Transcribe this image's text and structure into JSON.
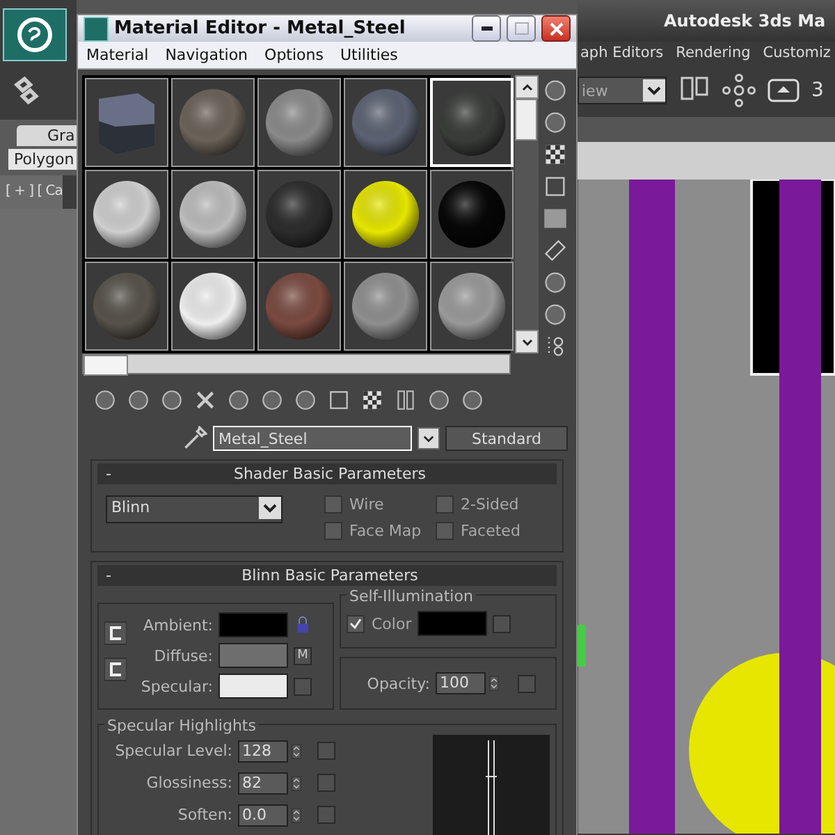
{
  "app": {
    "title": "Autodesk 3ds Ma",
    "menu": [
      "aph Editors",
      "Rendering",
      "Customiz"
    ],
    "view_dropdown": "iew",
    "toolbar_text": "3",
    "ribbon_tab": "Gra",
    "ribbon_panel": "Polygon",
    "viewport_label": "[ + ] [ Ca"
  },
  "window": {
    "title": "Material Editor - Metal_Steel",
    "menu": [
      "Material",
      "Navigation",
      "Options",
      "Utilities"
    ],
    "slots": [
      {
        "kind": "cube",
        "color": "#6a6f88",
        "selected": false
      },
      {
        "kind": "sphere",
        "color": "#6b6258",
        "selected": false
      },
      {
        "kind": "sphere",
        "color": "#8a8a8a",
        "selected": false
      },
      {
        "kind": "sphere",
        "color": "#5c6272",
        "selected": false
      },
      {
        "kind": "sphere",
        "color": "#3a3c3a",
        "selected": true
      },
      {
        "kind": "sphere",
        "color": "#cfcfcf",
        "selected": false
      },
      {
        "kind": "sphere",
        "color": "#bdbdbd",
        "selected": false
      },
      {
        "kind": "sphere",
        "color": "#2c2c2c",
        "selected": false
      },
      {
        "kind": "sphere",
        "color": "#e6e600",
        "selected": false
      },
      {
        "kind": "sphere",
        "color": "#060606",
        "selected": false
      },
      {
        "kind": "sphere",
        "color": "#57524b",
        "selected": false
      },
      {
        "kind": "sphere",
        "color": "#eeeeee",
        "selected": false
      },
      {
        "kind": "sphere",
        "color": "#7a4a40",
        "selected": false
      },
      {
        "kind": "sphere",
        "color": "#8f8f8f",
        "selected": false
      },
      {
        "kind": "sphere",
        "color": "#9a9a9a",
        "selected": false
      }
    ],
    "material_name": "Metal_Steel",
    "material_type": "Standard",
    "shader": {
      "collapse": "-",
      "title": "Shader Basic Parameters",
      "shader": "Blinn",
      "options": [
        {
          "label": "Wire",
          "checked": false
        },
        {
          "label": "2-Sided",
          "checked": false
        },
        {
          "label": "Face Map",
          "checked": false
        },
        {
          "label": "Faceted",
          "checked": false
        }
      ]
    },
    "basic": {
      "collapse": "-",
      "title": "Blinn Basic Parameters",
      "colors": [
        {
          "label": "Ambient:",
          "color": "#000000"
        },
        {
          "label": "Diffuse:",
          "color": "#6e6e6e"
        },
        {
          "label": "Specular:",
          "color": "#ebebeb"
        }
      ],
      "map_button": "M",
      "self_illumination": {
        "title": "Self-Illumination",
        "label": "Color",
        "checked": true,
        "color": "#000000"
      },
      "opacity": {
        "label": "Opacity:",
        "value": "100"
      }
    },
    "highlights": {
      "title": "Specular Highlights",
      "rows": [
        {
          "label": "Specular Level:",
          "value": "128"
        },
        {
          "label": "Glossiness:",
          "value": "82"
        },
        {
          "label": "Soften:",
          "value": "0.0"
        }
      ]
    }
  }
}
